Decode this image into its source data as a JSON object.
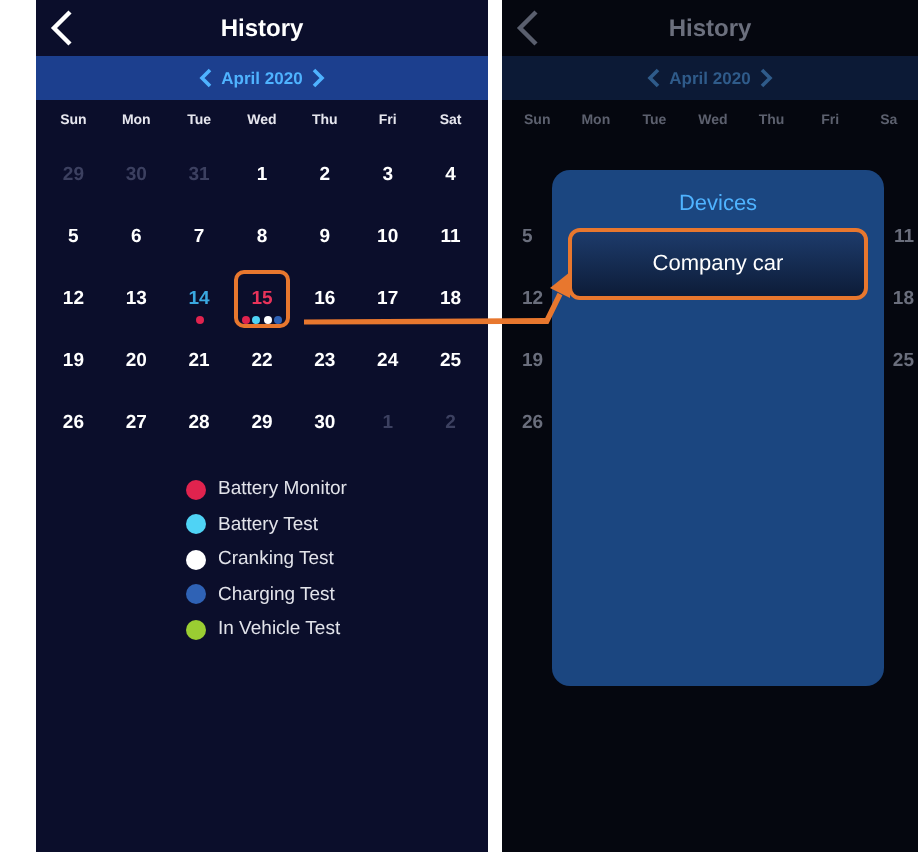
{
  "calendar_screen": {
    "title": "History",
    "month": "April 2020",
    "weekdays": [
      "Sun",
      "Mon",
      "Tue",
      "Wed",
      "Thu",
      "Fri",
      "Sat"
    ],
    "days": [
      {
        "label": "29",
        "muted": true,
        "today": false,
        "selected": false
      },
      {
        "label": "30",
        "muted": true,
        "today": false,
        "selected": false
      },
      {
        "label": "31",
        "muted": true,
        "today": false,
        "selected": false
      },
      {
        "label": "1",
        "muted": false,
        "today": false,
        "selected": false
      },
      {
        "label": "2",
        "muted": false,
        "today": false,
        "selected": false
      },
      {
        "label": "3",
        "muted": false,
        "today": false,
        "selected": false
      },
      {
        "label": "4",
        "muted": false,
        "today": false,
        "selected": false
      },
      {
        "label": "5",
        "muted": false,
        "today": false,
        "selected": false
      },
      {
        "label": "6",
        "muted": false,
        "today": false,
        "selected": false
      },
      {
        "label": "7",
        "muted": false,
        "today": false,
        "selected": false
      },
      {
        "label": "8",
        "muted": false,
        "today": false,
        "selected": false
      },
      {
        "label": "9",
        "muted": false,
        "today": false,
        "selected": false
      },
      {
        "label": "10",
        "muted": false,
        "today": false,
        "selected": false
      },
      {
        "label": "11",
        "muted": false,
        "today": false,
        "selected": false
      },
      {
        "label": "12",
        "muted": false,
        "today": false,
        "selected": false
      },
      {
        "label": "13",
        "muted": false,
        "today": false,
        "selected": false
      },
      {
        "label": "14",
        "muted": false,
        "today": true,
        "selected": false,
        "dots": [
          {
            "color": "#e0234e"
          }
        ]
      },
      {
        "label": "15",
        "muted": false,
        "today": false,
        "selected": true,
        "dots": [
          {
            "color": "#e0234e"
          },
          {
            "color": "#4fd3f5"
          },
          {
            "color": "#ffffff"
          },
          {
            "color": "#2f62b5"
          }
        ]
      },
      {
        "label": "16",
        "muted": false,
        "today": false,
        "selected": false
      },
      {
        "label": "17",
        "muted": false,
        "today": false,
        "selected": false
      },
      {
        "label": "18",
        "muted": false,
        "today": false,
        "selected": false
      },
      {
        "label": "19",
        "muted": false,
        "today": false,
        "selected": false
      },
      {
        "label": "20",
        "muted": false,
        "today": false,
        "selected": false
      },
      {
        "label": "21",
        "muted": false,
        "today": false,
        "selected": false
      },
      {
        "label": "22",
        "muted": false,
        "today": false,
        "selected": false
      },
      {
        "label": "23",
        "muted": false,
        "today": false,
        "selected": false
      },
      {
        "label": "24",
        "muted": false,
        "today": false,
        "selected": false
      },
      {
        "label": "25",
        "muted": false,
        "today": false,
        "selected": false
      },
      {
        "label": "26",
        "muted": false,
        "today": false,
        "selected": false
      },
      {
        "label": "27",
        "muted": false,
        "today": false,
        "selected": false
      },
      {
        "label": "28",
        "muted": false,
        "today": false,
        "selected": false
      },
      {
        "label": "29",
        "muted": false,
        "today": false,
        "selected": false
      },
      {
        "label": "30",
        "muted": false,
        "today": false,
        "selected": false
      },
      {
        "label": "1",
        "muted": true,
        "today": false,
        "selected": false
      },
      {
        "label": "2",
        "muted": true,
        "today": false,
        "selected": false
      }
    ],
    "legend": [
      {
        "label": "Battery Monitor",
        "color": "#e0234e"
      },
      {
        "label": "Battery Test",
        "color": "#4fd3f5"
      },
      {
        "label": "Cranking Test",
        "color": "#ffffff"
      },
      {
        "label": "Charging Test",
        "color": "#2f62b5"
      },
      {
        "label": "In Vehicle Test",
        "color": "#9acd32"
      }
    ]
  },
  "devices_screen": {
    "title": "History",
    "month": "April 2020",
    "weekdays": [
      "Sun",
      "Mon",
      "Tue",
      "Wed",
      "Thu",
      "Fri",
      "Sa"
    ],
    "left_column": [
      "5",
      "12",
      "19",
      "26"
    ],
    "right_column": [
      "11",
      "18",
      "25"
    ],
    "dialog": {
      "title": "Devices",
      "devices": [
        {
          "label": "Company car",
          "selected": true
        }
      ]
    }
  }
}
